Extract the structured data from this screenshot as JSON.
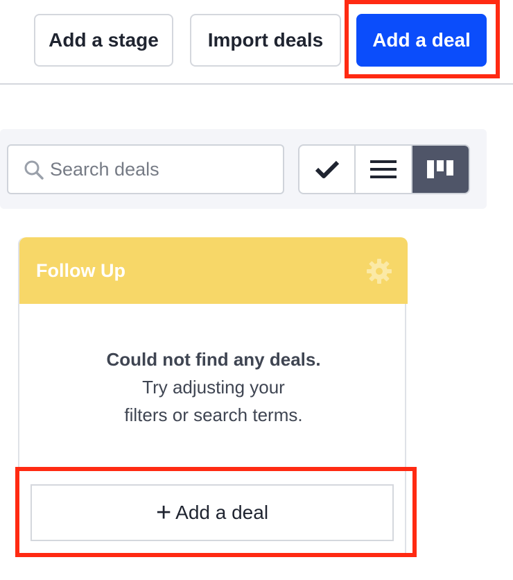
{
  "header": {
    "add_stage_label": "Add a stage",
    "import_deals_label": "Import deals",
    "add_deal_label": "Add a deal"
  },
  "toolbar": {
    "search_placeholder": "Search deals",
    "views": [
      {
        "name": "check-icon",
        "active": false
      },
      {
        "name": "list-icon",
        "active": false
      },
      {
        "name": "kanban-icon",
        "active": true
      }
    ]
  },
  "stage": {
    "title": "Follow Up",
    "header_color": "#f7d768",
    "empty_title": "Could not find any deals.",
    "empty_line1": "Try adjusting your",
    "empty_line2": "filters or search terms.",
    "add_deal_label": "Add a deal"
  },
  "colors": {
    "primary": "#0b4dfb",
    "highlight": "#ff2a12",
    "active_view": "#4f5568"
  }
}
